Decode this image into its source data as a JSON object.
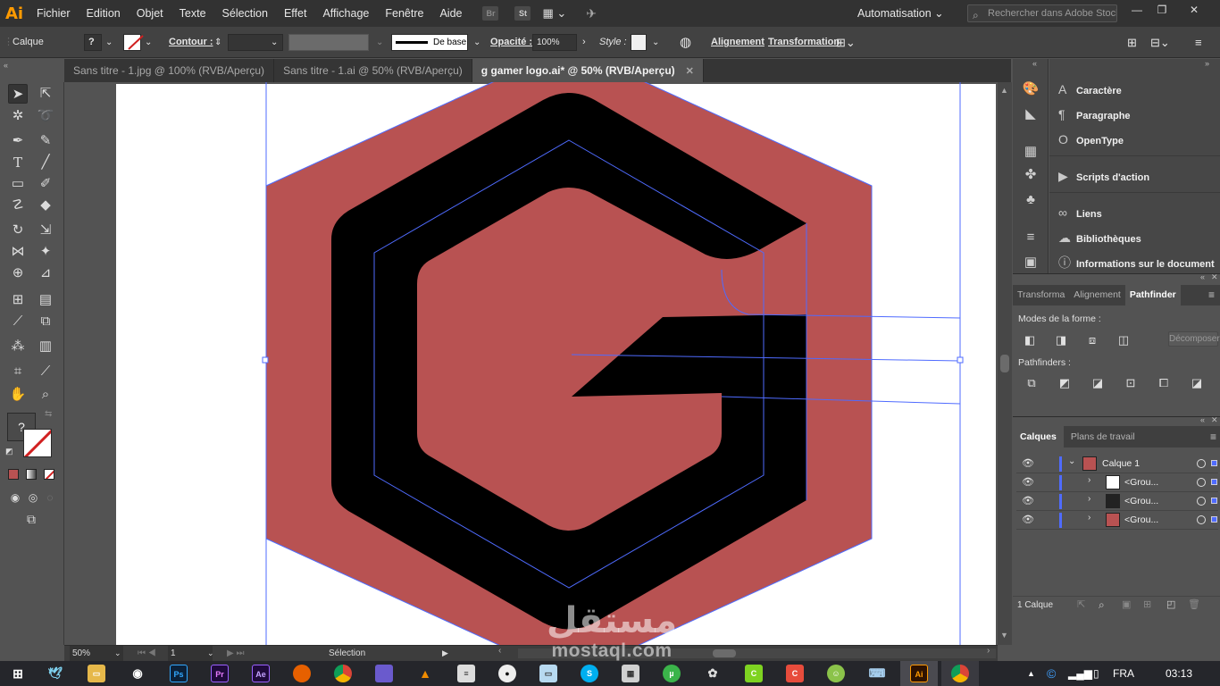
{
  "app": {
    "logo_text": "Ai",
    "menu": [
      "Fichier",
      "Edition",
      "Objet",
      "Texte",
      "Sélection",
      "Effet",
      "Affichage",
      "Fenêtre",
      "Aide"
    ],
    "bridge_label": "Br",
    "stock_label": "St",
    "workspace_label": "Automatisation",
    "search_placeholder": "Rechercher dans Adobe Stock"
  },
  "control_bar": {
    "selection_label": "Calque",
    "fill_label": "?",
    "stroke_label": "Contour :",
    "brush_label": "De base",
    "opacity_label": "Opacité :",
    "opacity_value": "100%",
    "style_label": "Style :",
    "align_label": "Alignement",
    "transform_label": "Transformation"
  },
  "tabs": [
    {
      "label": "Sans titre - 1.jpg @ 100% (RVB/Aperçu)",
      "active": false
    },
    {
      "label": "Sans titre - 1.ai @ 50% (RVB/Aperçu)",
      "active": false
    },
    {
      "label": "g gamer logo.ai* @ 50% (RVB/Aperçu)",
      "active": true
    }
  ],
  "tools_panel": {
    "fill_stroke_unknown": "?"
  },
  "status_bar": {
    "zoom": "50%",
    "artboard_number": "1",
    "tool_name": "Sélection"
  },
  "right_panels": {
    "items": [
      {
        "label": "Caractère",
        "icon": "character-icon"
      },
      {
        "label": "Paragraphe",
        "icon": "paragraph-icon"
      },
      {
        "label": "OpenType",
        "icon": "opentype-icon"
      },
      {
        "label": "Scripts d'action",
        "icon": "play-icon"
      },
      {
        "label": "Liens",
        "icon": "link-icon"
      },
      {
        "label": "Bibliothèques",
        "icon": "libraries-icon"
      },
      {
        "label": "Informations sur le document",
        "icon": "document-info-icon"
      }
    ]
  },
  "pathfinder": {
    "tabs": [
      "Transforma",
      "Alignement",
      "Pathfinder"
    ],
    "active_tab": "Pathfinder",
    "shape_modes_label": "Modes de la forme :",
    "expand_label": "Décomposer",
    "pathfinders_label": "Pathfinders :"
  },
  "layers": {
    "tabs": [
      "Calques",
      "Plans de travail"
    ],
    "active_tab": "Calques",
    "rows": [
      {
        "name": "Calque 1",
        "level": 0,
        "expanded": true
      },
      {
        "name": "<Grou...",
        "level": 1,
        "expanded": false
      },
      {
        "name": "<Grou...",
        "level": 1,
        "expanded": false
      },
      {
        "name": "<Grou...",
        "level": 1,
        "expanded": false
      }
    ],
    "footer_count": "1 Calque"
  },
  "taskbar": {
    "language": "FRA",
    "time": "03:13",
    "apps": [
      "Ps",
      "Pr",
      "Ae",
      "Ai"
    ]
  },
  "watermark": {
    "arabic_text": "مستقل",
    "latin_text": "mostaql.com"
  },
  "colors": {
    "hexagon_fill": "#b85252",
    "g_fill": "#000000",
    "selection_stroke": "#4f6bff",
    "illustrator_orange": "#ff9a00",
    "active_layer_accent": "#4f6bff"
  }
}
